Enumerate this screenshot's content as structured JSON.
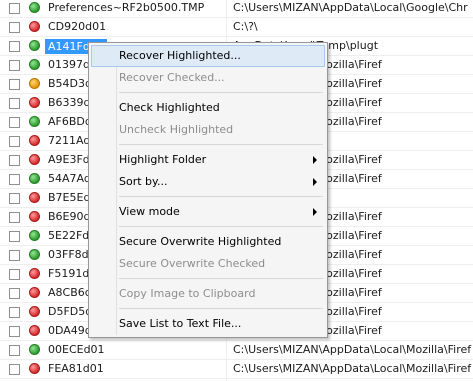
{
  "files": [
    {
      "name": "Preferences~RF2b0500.TMP",
      "path": "C:\\Users\\MIZAN\\AppData\\Local\\Google\\Chr",
      "status": "green"
    },
    {
      "name": "CD920d01",
      "path": "C:\\?\\",
      "status": "red"
    },
    {
      "name": "A141Fd01",
      "path": "AppData\\Local\\Temp\\plugt",
      "status": "green",
      "selected": true
    },
    {
      "name": "01397d01",
      "path": "AppData\\Local\\Mozilla\\Firef",
      "status": "green"
    },
    {
      "name": "B54D3d01",
      "path": "AppData\\Local\\Mozilla\\Firef",
      "status": "orange"
    },
    {
      "name": "B6339d01",
      "path": "AppData\\Local\\Mozilla\\Firef",
      "status": "red"
    },
    {
      "name": "AF6BDd01",
      "path": "AppData\\Local\\Mozilla\\Firef",
      "status": "green"
    },
    {
      "name": "7211Ad01",
      "path": "",
      "status": "red"
    },
    {
      "name": "A9E3Fd01",
      "path": "AppData\\Local\\Mozilla\\Firef",
      "status": "red"
    },
    {
      "name": "54A7Ad01",
      "path": "AppData\\Local\\Mozilla\\Firef",
      "status": "green"
    },
    {
      "name": "B7E5Ed01",
      "path": "",
      "status": "red"
    },
    {
      "name": "B6E90d01",
      "path": "AppData\\Local\\Mozilla\\Firef",
      "status": "red"
    },
    {
      "name": "5E22Fd01",
      "path": "AppData\\Local\\Mozilla\\Firef",
      "status": "green"
    },
    {
      "name": "03FF8d01",
      "path": "AppData\\Local\\Mozilla\\Firef",
      "status": "green"
    },
    {
      "name": "F5191d01",
      "path": "AppData\\Local\\Mozilla\\Firef",
      "status": "red"
    },
    {
      "name": "A8CB6d01",
      "path": "AppData\\Local\\Mozilla\\Firef",
      "status": "red"
    },
    {
      "name": "D5FD5d01",
      "path": "AppData\\Local\\Mozilla\\Firef",
      "status": "red"
    },
    {
      "name": "0DA49d01",
      "path": "AppData\\Local\\Mozilla\\Firef",
      "status": "red"
    },
    {
      "name": "00ECEd01",
      "path": "C:\\Users\\MIZAN\\AppData\\Local\\Mozilla\\Firef",
      "status": "green"
    },
    {
      "name": "FEA81d01",
      "path": "C:\\Users\\MIZAN\\AppData\\Local\\Mozilla\\Firef",
      "status": "red"
    }
  ],
  "context_menu": {
    "recover_highlighted": "Recover Highlighted...",
    "recover_checked": "Recover Checked...",
    "check_highlighted": "Check Highlighted",
    "uncheck_highlighted": "Uncheck Highlighted",
    "highlight_folder": "Highlight Folder",
    "sort_by": "Sort by...",
    "view_mode": "View mode",
    "secure_overwrite_highlighted": "Secure Overwrite Highlighted",
    "secure_overwrite_checked": "Secure Overwrite Checked",
    "copy_image": "Copy Image to Clipboard",
    "save_list": "Save List to Text File..."
  },
  "colors": {
    "selection": "#3399ff",
    "status_green": "#2e9b2e",
    "status_red": "#d62a2a",
    "status_orange": "#e59500"
  }
}
